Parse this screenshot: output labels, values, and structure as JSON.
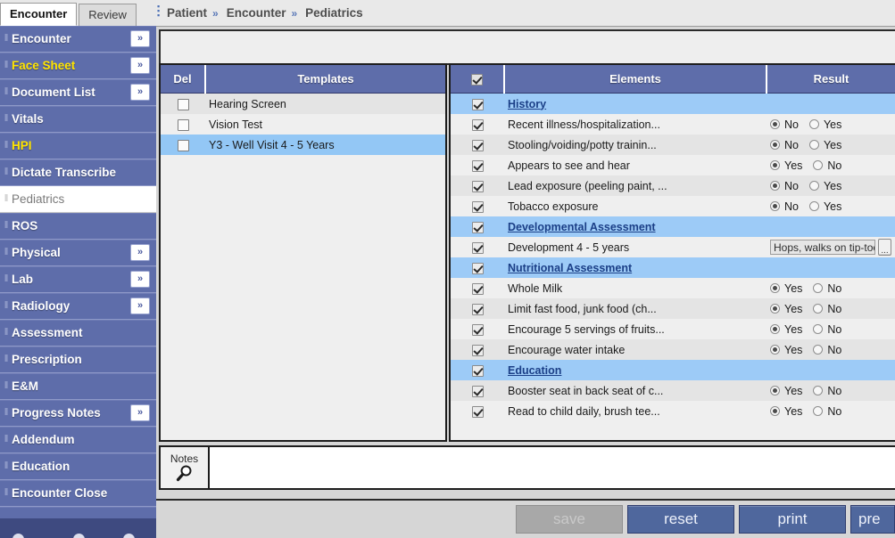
{
  "tabs": [
    {
      "label": "Encounter",
      "active": true
    },
    {
      "label": "Review",
      "active": false
    }
  ],
  "breadcrumb": {
    "items": [
      "Patient",
      "Encounter",
      "Pediatrics"
    ],
    "separator": "»"
  },
  "sidebar": {
    "items": [
      {
        "label": "Encounter",
        "expand": "»",
        "style": "normal"
      },
      {
        "label": "Face Sheet",
        "expand": "»",
        "style": "yellow"
      },
      {
        "label": "Document List",
        "expand": "»",
        "style": "normal"
      },
      {
        "label": "Vitals",
        "expand": "",
        "style": "normal"
      },
      {
        "label": "HPI",
        "expand": "",
        "style": "yellow"
      },
      {
        "label": "Dictate Transcribe",
        "expand": "",
        "style": "normal"
      },
      {
        "label": "Pediatrics",
        "expand": "",
        "style": "selected"
      },
      {
        "label": "ROS",
        "expand": "",
        "style": "normal"
      },
      {
        "label": "Physical",
        "expand": "»",
        "style": "normal"
      },
      {
        "label": "Lab",
        "expand": "»",
        "style": "normal"
      },
      {
        "label": "Radiology",
        "expand": "»",
        "style": "normal"
      },
      {
        "label": "Assessment",
        "expand": "",
        "style": "normal"
      },
      {
        "label": "Prescription",
        "expand": "",
        "style": "normal"
      },
      {
        "label": "E&M",
        "expand": "",
        "style": "normal"
      },
      {
        "label": "Progress Notes",
        "expand": "»",
        "style": "normal"
      },
      {
        "label": "Addendum",
        "expand": "",
        "style": "normal"
      },
      {
        "label": "Education",
        "expand": "",
        "style": "normal"
      },
      {
        "label": "Encounter Close",
        "expand": "",
        "style": "normal"
      }
    ],
    "grip_glyph": "‖"
  },
  "templates_panel": {
    "columns": [
      "Del",
      "Templates"
    ],
    "rows": [
      {
        "checked": false,
        "name": "Hearing Screen",
        "selected": false
      },
      {
        "checked": false,
        "name": "Vision Test",
        "selected": false
      },
      {
        "checked": false,
        "name": "Y3 - Well Visit 4 - 5 Years",
        "selected": true
      }
    ]
  },
  "elements_panel": {
    "columns": [
      "",
      "Elements",
      "Result"
    ],
    "header_checkbox_checked": true,
    "rows": [
      {
        "type": "group",
        "checked": true,
        "label": "History"
      },
      {
        "type": "radio",
        "checked": true,
        "label": "Recent illness/hospitalization...",
        "options": [
          "No",
          "Yes"
        ],
        "selected": "No"
      },
      {
        "type": "radio",
        "checked": true,
        "label": "Stooling/voiding/potty trainin...",
        "options": [
          "No",
          "Yes"
        ],
        "selected": "No"
      },
      {
        "type": "radio",
        "checked": true,
        "label": "Appears to see and hear",
        "options": [
          "Yes",
          "No"
        ],
        "selected": "Yes"
      },
      {
        "type": "radio",
        "checked": true,
        "label": "Lead exposure (peeling paint, ...",
        "options": [
          "No",
          "Yes"
        ],
        "selected": "No"
      },
      {
        "type": "radio",
        "checked": true,
        "label": "Tobacco exposure",
        "options": [
          "No",
          "Yes"
        ],
        "selected": "No"
      },
      {
        "type": "group",
        "checked": true,
        "label": "Developmental Assessment"
      },
      {
        "type": "text",
        "checked": true,
        "label": "Development 4 - 5 years",
        "value": "Hops, walks on tip-toes,Ri",
        "button": "..."
      },
      {
        "type": "group",
        "checked": true,
        "label": "Nutritional Assessment"
      },
      {
        "type": "radio",
        "checked": true,
        "label": "Whole Milk",
        "options": [
          "Yes",
          "No"
        ],
        "selected": "Yes"
      },
      {
        "type": "radio",
        "checked": true,
        "label": "Limit fast food, junk food (ch...",
        "options": [
          "Yes",
          "No"
        ],
        "selected": "Yes"
      },
      {
        "type": "radio",
        "checked": true,
        "label": "Encourage 5 servings of fruits...",
        "options": [
          "Yes",
          "No"
        ],
        "selected": "Yes"
      },
      {
        "type": "radio",
        "checked": true,
        "label": "Encourage water intake",
        "options": [
          "Yes",
          "No"
        ],
        "selected": "Yes"
      },
      {
        "type": "group",
        "checked": true,
        "label": "Education"
      },
      {
        "type": "radio",
        "checked": true,
        "label": "Booster seat in back seat of c...",
        "options": [
          "Yes",
          "No"
        ],
        "selected": "Yes"
      },
      {
        "type": "radio",
        "checked": true,
        "label": "Read to child daily, brush tee...",
        "options": [
          "Yes",
          "No"
        ],
        "selected": "Yes"
      }
    ]
  },
  "notes": {
    "label": "Notes",
    "icon": "magnifier-icon",
    "value": ""
  },
  "action_buttons": [
    {
      "label": "save",
      "disabled": true
    },
    {
      "label": "reset",
      "disabled": false
    },
    {
      "label": "print",
      "disabled": false
    },
    {
      "label": "pre",
      "disabled": false,
      "clipped": true
    }
  ],
  "colors": {
    "nav_blue": "#5e6daa",
    "header_blue": "#5e6daa",
    "group_row": "#9dcbf7",
    "selected_row": "#93c7f5",
    "accent_yellow": "#ffe400",
    "button_blue": "#4f679d",
    "link_blue": "#1b3f87"
  }
}
